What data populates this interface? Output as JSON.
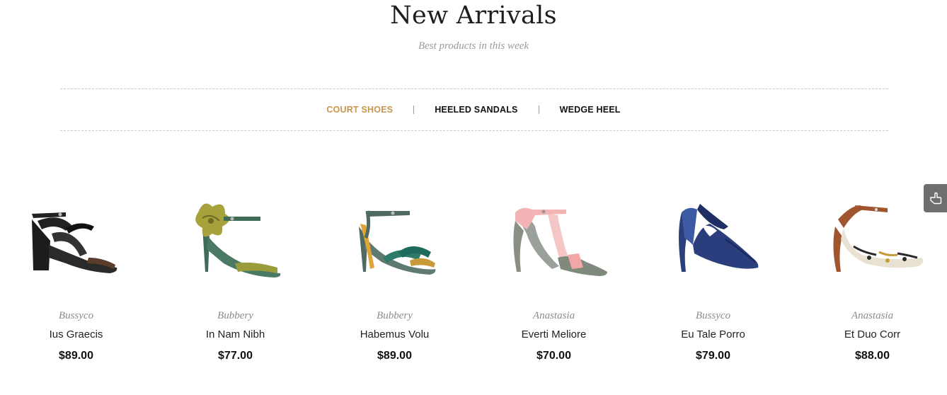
{
  "header": {
    "title": "New Arrivals",
    "subtitle": "Best products in this week"
  },
  "tabs": [
    {
      "label": "COURT SHOES",
      "active": true
    },
    {
      "label": "HEELED SANDALS",
      "active": false
    },
    {
      "label": "WEDGE HEEL",
      "active": false
    }
  ],
  "products": [
    {
      "brand": "Bussyco",
      "name": "Ius Graecis",
      "price": "$89.00",
      "icon": "black-strappy-sandal"
    },
    {
      "brand": "Bubbery",
      "name": "In Nam Nibh",
      "price": "$77.00",
      "icon": "green-flower-sandal"
    },
    {
      "brand": "Bubbery",
      "name": "Habemus Volu",
      "price": "$89.00",
      "icon": "teal-ankle-strap-sandal"
    },
    {
      "brand": "Anastasia",
      "name": "Everti Meliore",
      "price": "$70.00",
      "icon": "pink-t-strap-sandal"
    },
    {
      "brand": "Bussyco",
      "name": "Eu Tale Porro",
      "price": "$79.00",
      "icon": "navy-pointed-pump"
    },
    {
      "brand": "Anastasia",
      "name": "Et Duo Corr",
      "price": "$88.00",
      "icon": "patterned-slingback-pump"
    }
  ],
  "colors": {
    "accent": "#c8964e",
    "text": "#222222",
    "muted": "#8c8c8c"
  }
}
